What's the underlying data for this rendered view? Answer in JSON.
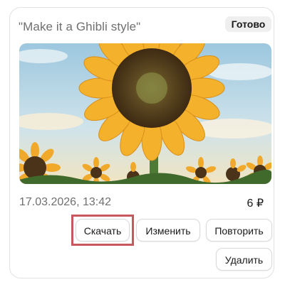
{
  "card": {
    "prompt": "\"Make it a Ghibli style\"",
    "status_badge": "Готово",
    "image_subject": "sunflower",
    "date": "17.03.2026, 13:42",
    "price": "6 ₽"
  },
  "actions": {
    "download_label": "Скачать",
    "edit_label": "Изменить",
    "repeat_label": "Повторить",
    "delete_label": "Удалить"
  },
  "colors": {
    "highlight": "#c7585d",
    "sky": "#bcd8e6",
    "petals": "#f3b12c",
    "seed_center": "#6b4a1f"
  }
}
